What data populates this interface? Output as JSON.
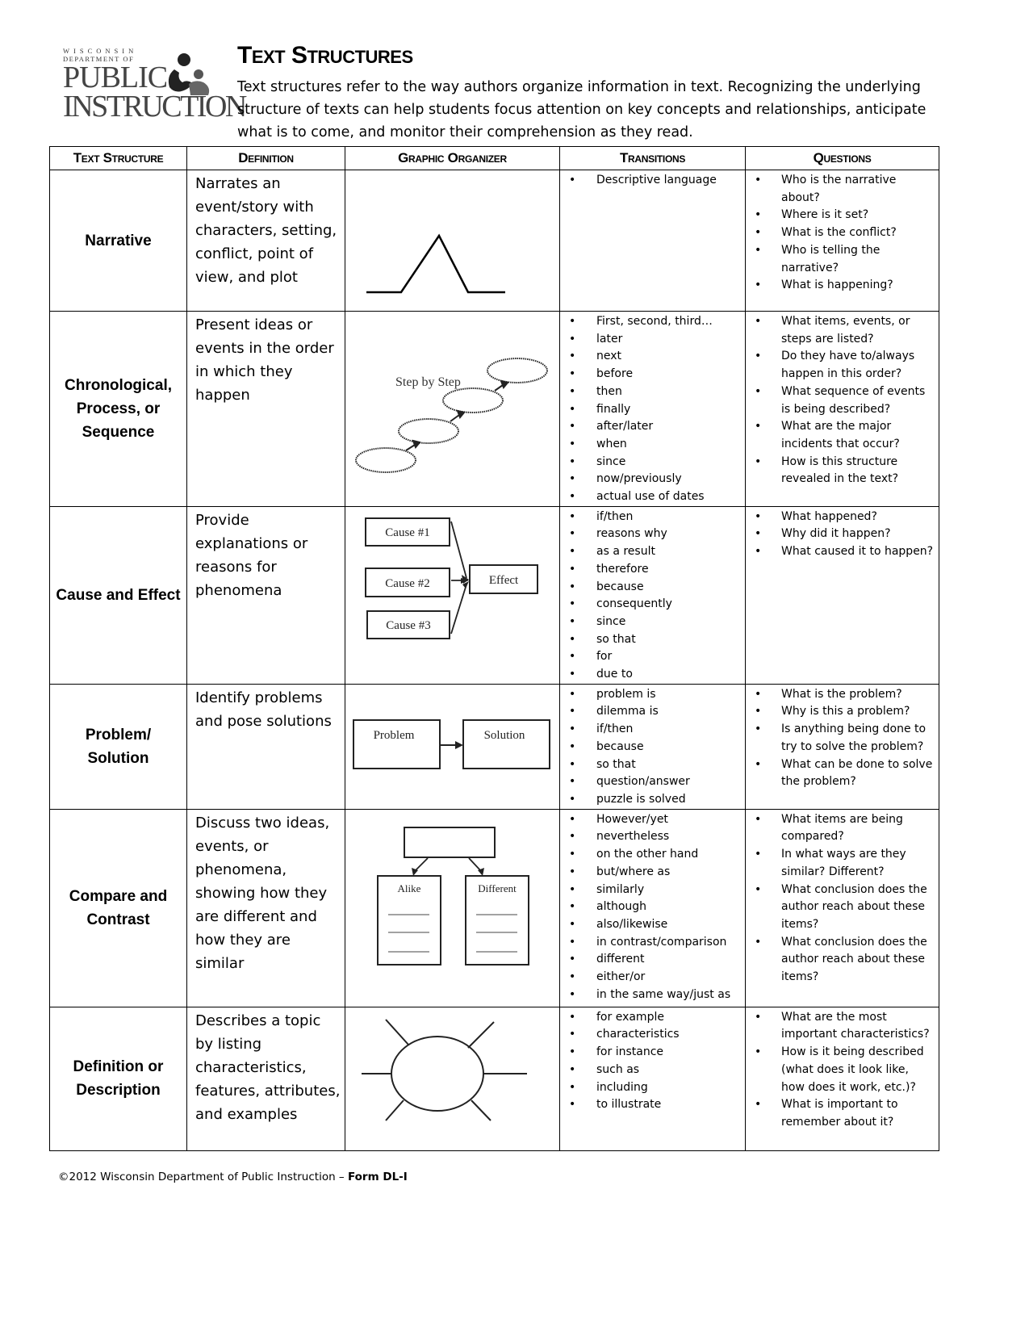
{
  "logo": {
    "line1": "WISCONSIN",
    "line2": "DEPARTMENT OF",
    "line3": "PUBLIC",
    "line4": "INSTRUCTION",
    "icon": "reading-figures-icon"
  },
  "header": {
    "title_T": "T",
    "title_ext": "EXT",
    "title_S": "S",
    "title_tructures": "TRUCTURES",
    "intro": "Text structures refer to the way authors organize information in text.  Recognizing the underlying structure of texts can help students focus attention on key concepts and relationships, anticipate what is to come, and monitor their comprehension as they read."
  },
  "table": {
    "headers": [
      "Text Structure",
      "Definition",
      "Graphic Organizer",
      "Transitions",
      "Questions"
    ],
    "rows": [
      {
        "structure": "Narrative",
        "definition": "Narrates an event/story with characters, setting, conflict, point of view, and plot",
        "organizer": {
          "type": "narrative-arc-icon",
          "labels": []
        },
        "transitions": [
          "Descriptive language"
        ],
        "questions": [
          "Who is the narrative about?",
          "Where is it set?",
          "What is the conflict?",
          "Who is telling the narrative?",
          "What is happening?"
        ]
      },
      {
        "structure": "Chronological, Process, or Sequence",
        "definition": "Present ideas or events in the order in which they happen",
        "organizer": {
          "type": "step-by-step-icon",
          "labels": [
            "Step by Step"
          ]
        },
        "transitions": [
          "First, second, third…",
          "later",
          "next",
          "before",
          "then",
          "finally",
          "after/later",
          "when",
          "since",
          "now/previously",
          "actual use of dates"
        ],
        "questions": [
          "What items, events, or steps are listed?",
          "Do they have to/always happen in this order?",
          "What sequence of events is being described?",
          "What are the major incidents that occur?",
          "How is this structure revealed in the text?"
        ]
      },
      {
        "structure": "Cause and Effect",
        "definition": "Provide explanations or reasons for phenomena",
        "organizer": {
          "type": "cause-effect-icon",
          "labels": [
            "Cause #1",
            "Cause #2",
            "Cause #3",
            "Effect"
          ]
        },
        "transitions": [
          "if/then",
          "reasons why",
          "as a result",
          "therefore",
          "because",
          "consequently",
          "since",
          "so that",
          "for",
          "due to"
        ],
        "questions": [
          "What happened?",
          "Why did it happen?",
          "What caused it to happen?"
        ]
      },
      {
        "structure": "Problem/ Solution",
        "definition": "Identify problems and pose solutions",
        "organizer": {
          "type": "problem-solution-icon",
          "labels": [
            "Problem",
            "Solution"
          ]
        },
        "transitions": [
          "problem is",
          "dilemma is",
          "if/then",
          "because",
          "so that",
          "question/answer",
          "puzzle is solved"
        ],
        "questions": [
          "What is the problem?",
          "Why is this a problem?",
          "Is anything being done to try to solve the problem?",
          "What can be done to solve the problem?"
        ]
      },
      {
        "structure": "Compare and Contrast",
        "definition": "Discuss two ideas, events, or phenomena, showing how they are different and how they are similar",
        "organizer": {
          "type": "compare-contrast-icon",
          "labels": [
            "Alike",
            "Different"
          ]
        },
        "transitions": [
          "However/yet",
          "nevertheless",
          "on the other hand",
          "but/where as",
          "similarly",
          "although",
          "also/likewise",
          "in contrast/comparison",
          "different",
          "either/or",
          "in the same way/just as"
        ],
        "questions": [
          "What items are being compared?",
          "In what ways are they similar? Different?",
          "What conclusion does the author reach about these items?",
          "What conclusion does the author reach about these items?"
        ]
      },
      {
        "structure": "Definition or Description",
        "definition": "Describes a topic by listing characteristics, features, attributes, and examples",
        "organizer": {
          "type": "web-diagram-icon",
          "labels": []
        },
        "transitions": [
          "for example",
          "characteristics",
          "for instance",
          "such as",
          "including",
          "to illustrate"
        ],
        "questions": [
          "What are the most important characteristics?",
          "How is it being described (what does it look like, how does it work, etc.)?",
          "What is important to remember about it?"
        ]
      }
    ]
  },
  "footer": {
    "text": "©2012 Wisconsin Department of Public Instruction – ",
    "form": "Form DL-I"
  }
}
